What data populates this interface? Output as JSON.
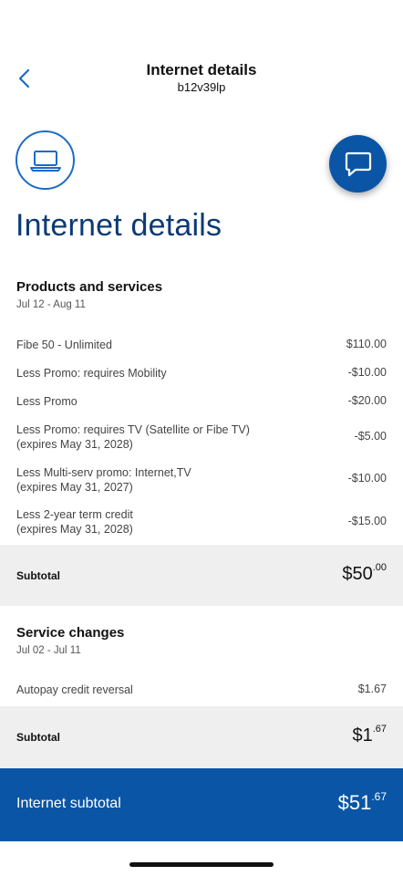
{
  "header": {
    "title": "Internet details",
    "subtitle": "b12v39lp",
    "back_icon": "chevron-left-icon"
  },
  "icons": {
    "service_icon": "laptop-icon",
    "chat_icon": "chat-bubble-icon"
  },
  "page_title": "Internet details",
  "products": {
    "title": "Products and services",
    "date_range": "Jul 12 - Aug 11",
    "items": [
      {
        "label_line1": "Fibe 50 - Unlimited",
        "label_line2": "",
        "amount": "$110.00"
      },
      {
        "label_line1": "Less Promo: requires Mobility",
        "label_line2": "",
        "amount": "-$10.00"
      },
      {
        "label_line1": "Less Promo",
        "label_line2": "",
        "amount": "-$20.00"
      },
      {
        "label_line1": "Less Promo: requires TV (Satellite or Fibe TV)",
        "label_line2": "(expires May 31, 2028)",
        "amount": "-$5.00"
      },
      {
        "label_line1": "Less Multi-serv promo: Internet,TV",
        "label_line2": "(expires May 31, 2027)",
        "amount": "-$10.00"
      },
      {
        "label_line1": "Less 2-year term credit",
        "label_line2": "(expires May 31, 2028)",
        "amount": "-$15.00"
      }
    ],
    "subtotal_label": "Subtotal",
    "subtotal_dollars": "$50",
    "subtotal_cents": ".00"
  },
  "service_changes": {
    "title": "Service changes",
    "date_range": "Jul 02 - Jul 11",
    "items": [
      {
        "label_line1": "Autopay credit reversal",
        "amount": "$1.67"
      }
    ],
    "subtotal_label": "Subtotal",
    "subtotal_dollars": "$1",
    "subtotal_cents": ".67"
  },
  "internet_total": {
    "label": "Internet subtotal",
    "dollars": "$51",
    "cents": ".67"
  },
  "colors": {
    "brand_blue": "#0a55a5",
    "title_navy": "#0b3a75",
    "outline_blue": "#1b6cc5",
    "subtotal_gray": "#efefef"
  }
}
